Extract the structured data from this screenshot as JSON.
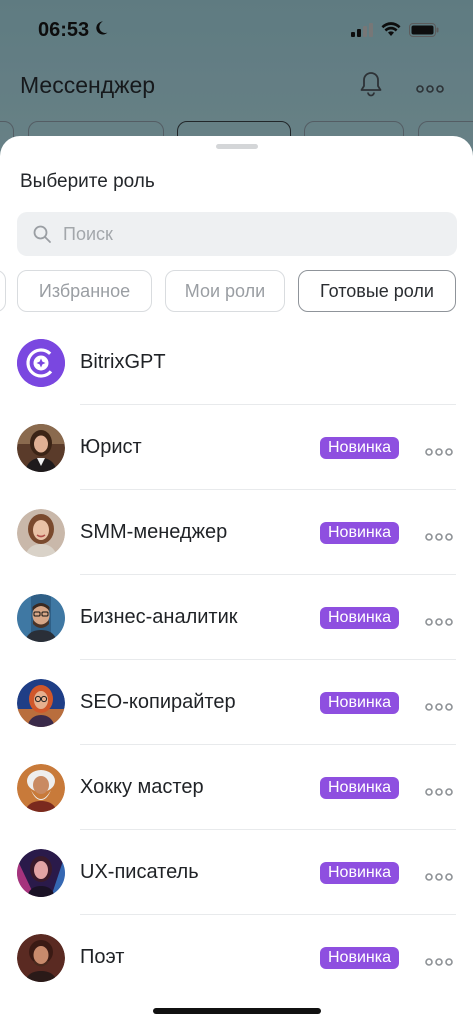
{
  "status_bar": {
    "time": "06:53"
  },
  "background": {
    "title": "Мессенджер"
  },
  "sheet": {
    "title": "Выберите роль",
    "search": {
      "placeholder": "Поиск",
      "value": ""
    },
    "tabs": [
      {
        "label": "Избранное",
        "active": false
      },
      {
        "label": "Мои роли",
        "active": false
      },
      {
        "label": "Готовые роли",
        "active": true
      }
    ],
    "roles": [
      {
        "name": "BitrixGPT",
        "badge": "",
        "avatar": "bitrixgpt-logo"
      },
      {
        "name": "Юрист",
        "badge": "Новинка",
        "avatar": "lawyer-portrait"
      },
      {
        "name": "SMM-менеджер",
        "badge": "Новинка",
        "avatar": "smm-portrait"
      },
      {
        "name": "Бизнес-аналитик",
        "badge": "Новинка",
        "avatar": "analyst-portrait"
      },
      {
        "name": "SEO-копирайтер",
        "badge": "Новинка",
        "avatar": "seo-portrait"
      },
      {
        "name": "Хокку мастер",
        "badge": "Новинка",
        "avatar": "haiku-portrait"
      },
      {
        "name": "UX-писатель",
        "badge": "Новинка",
        "avatar": "ux-portrait"
      },
      {
        "name": "Поэт",
        "badge": "Новинка",
        "avatar": "poet-portrait"
      }
    ]
  },
  "colors": {
    "accent_badge": "#8e4fe0",
    "bitrixgpt_logo": "#7a47e0"
  }
}
